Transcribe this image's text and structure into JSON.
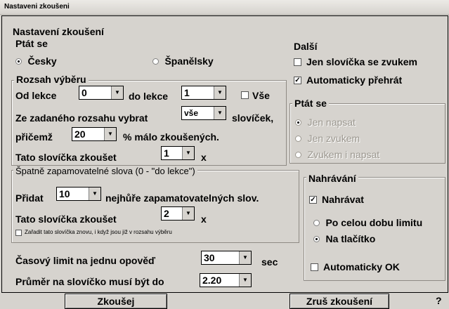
{
  "window": {
    "title": "Nastaveni zkoušeni"
  },
  "main_group": {
    "title": "Nastavení zkoušení"
  },
  "ptat_se_lang": {
    "title": "Ptát se",
    "option_cesky": "Česky",
    "option_spanelsky": "Španělsky",
    "selected": "Česky"
  },
  "rozsah": {
    "title": "Rozsah výběru",
    "od_lekce_label": "Od lekce",
    "od_lekce_value": "0",
    "do_lekce_label": "do lekce",
    "do_lekce_value": "1",
    "vse_label": "Vše",
    "vse_checked": false,
    "vybrat_label": "Ze zadaného rozsahu vybrat",
    "vybrat_value": "vše",
    "slovicek_label": "slovíček,",
    "pricemz_label": "přičemž",
    "pricemz_value": "20",
    "malo_label": "% málo zkoušených.",
    "zkouset_label": "Tato slovíčka zkoušet",
    "zkouset_value": "1",
    "x_label": "x"
  },
  "dalsi": {
    "title": "Další",
    "zvukem_label": "Jen slovíčka se zvukem",
    "zvukem_checked": false,
    "prehrat_label": "Automaticky přehrát",
    "prehrat_checked": true
  },
  "ptat_se_mode": {
    "title": "Ptát se",
    "opt1": "Jen napsat",
    "opt2": "Jen zvukem",
    "opt3": "Zvukem i napsat",
    "selected": "Jen napsat"
  },
  "spatne": {
    "title": "Špatně zapamovatelné slova (0 - \"do lekce\")",
    "pridat_label": "Přidat",
    "pridat_value": "10",
    "nejhure_label": "nejhůře zapamatovatelných slov.",
    "zkouset_label": "Tato slovíčka zkoušet",
    "zkouset_value": "2",
    "x_label": "x",
    "zaradit_label": "Zařadit tato slovíčka znovu, i když jsou již v rozsahu výběru",
    "zaradit_checked": false
  },
  "nahravani": {
    "title": "Nahrávání",
    "nahravat_label": "Nahrávat",
    "nahravat_checked": true,
    "opt_limit": "Po celou dobu limitu",
    "opt_tlacitko": "Na tlačítko",
    "selected": "Na tlačítko",
    "auto_ok_label": "Automaticky OK",
    "auto_ok_checked": false
  },
  "limit": {
    "label": "Časový limit na jednu opověď",
    "value": "30",
    "unit": "sec"
  },
  "prumer": {
    "label": "Průměr na slovíčko musí být do",
    "value": "2.20"
  },
  "buttons": {
    "zkousej": "Zkoušej",
    "zrus": "Zruš zkoušení",
    "help": "?"
  },
  "glyphs": {
    "checkmark": "✓",
    "arrow": "▼"
  }
}
